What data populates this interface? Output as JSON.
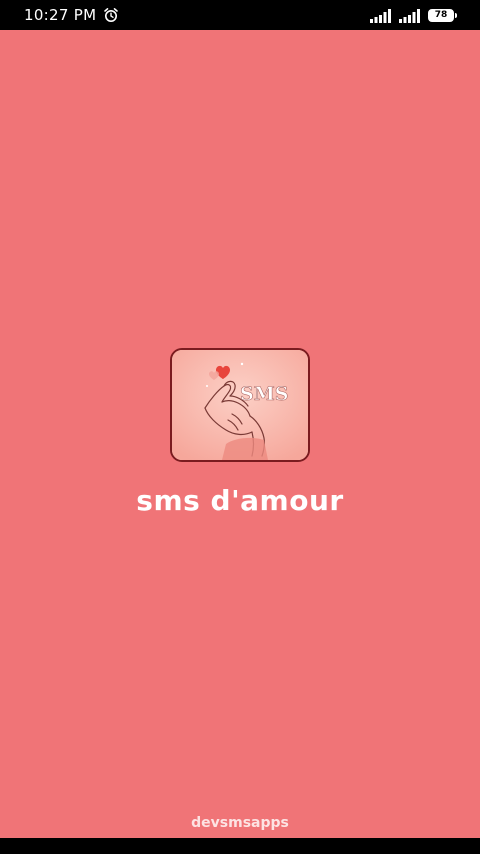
{
  "status_bar": {
    "time": "10:27 PM",
    "battery_level": "78",
    "icons": [
      "alarm-icon",
      "signal-icon",
      "signal-icon",
      "battery-icon"
    ]
  },
  "splash": {
    "logo_text": "SMS",
    "app_name": "sms d'amour",
    "developer": "devsmsapps"
  },
  "colors": {
    "background": "#f07477",
    "logo_background": "#f9b9ae",
    "logo_border": "#7a1b1f",
    "heart": "#e8453c"
  }
}
